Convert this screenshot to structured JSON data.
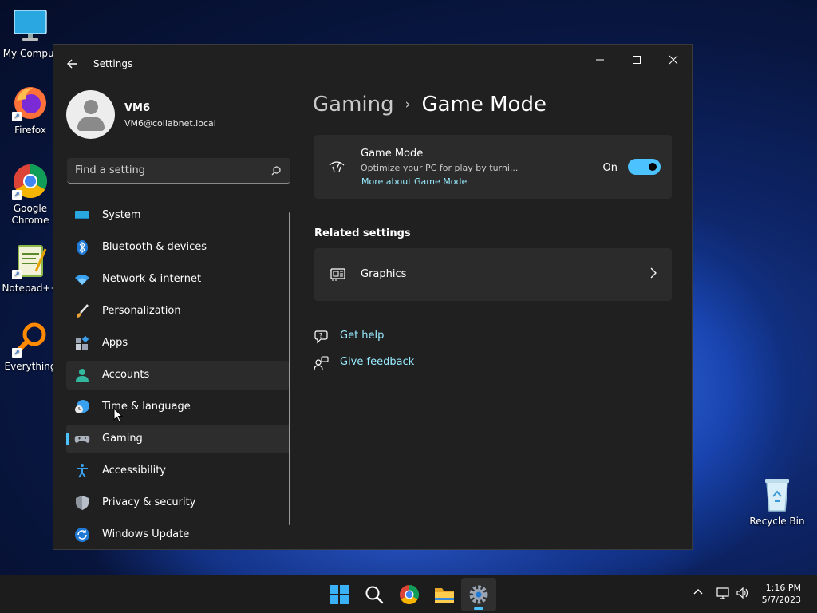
{
  "desktop": {
    "icons": [
      {
        "label": "My Comput",
        "icon": "monitor-icon"
      },
      {
        "label": "Firefox",
        "icon": "firefox-icon"
      },
      {
        "label": "Google Chrome",
        "icon": "chrome-icon"
      },
      {
        "label": "Notepad++",
        "icon": "notepadpp-icon"
      },
      {
        "label": "Everything",
        "icon": "everything-icon"
      },
      {
        "label": "Recycle Bin",
        "icon": "recycle-bin-icon"
      }
    ]
  },
  "window": {
    "title": "Settings",
    "controls": {
      "minimize": "—",
      "maximize": "☐",
      "close": "✕"
    }
  },
  "profile": {
    "name": "VM6",
    "email": "VM6@collabnet.local"
  },
  "search": {
    "placeholder": "Find a setting"
  },
  "nav": {
    "items": [
      {
        "label": "System",
        "icon": "system-icon"
      },
      {
        "label": "Bluetooth & devices",
        "icon": "bluetooth-icon"
      },
      {
        "label": "Network & internet",
        "icon": "wifi-icon"
      },
      {
        "label": "Personalization",
        "icon": "brush-icon"
      },
      {
        "label": "Apps",
        "icon": "apps-icon"
      },
      {
        "label": "Accounts",
        "icon": "accounts-icon"
      },
      {
        "label": "Time & language",
        "icon": "globe-clock-icon"
      },
      {
        "label": "Gaming",
        "icon": "gamepad-icon"
      },
      {
        "label": "Accessibility",
        "icon": "accessibility-icon"
      },
      {
        "label": "Privacy & security",
        "icon": "shield-icon"
      },
      {
        "label": "Windows Update",
        "icon": "update-icon"
      }
    ],
    "active": "Gaming",
    "hovered": "Accounts"
  },
  "breadcrumb": {
    "parent": "Gaming",
    "separator": "›",
    "current": "Game Mode"
  },
  "game_mode": {
    "title": "Game Mode",
    "description": "Optimize your PC for play by turni...",
    "link": "More about Game Mode",
    "toggle_label": "On",
    "toggle_on": true
  },
  "related": {
    "title": "Related settings",
    "graphics_label": "Graphics"
  },
  "help": {
    "get_help": "Get help",
    "give_feedback": "Give feedback"
  },
  "taskbar": {
    "time": "1:16 PM",
    "date": "5/7/2023"
  },
  "colors": {
    "accent": "#4cc2ff",
    "link": "#99ebff",
    "window_bg": "#202020",
    "card_bg": "#2b2b2b"
  }
}
